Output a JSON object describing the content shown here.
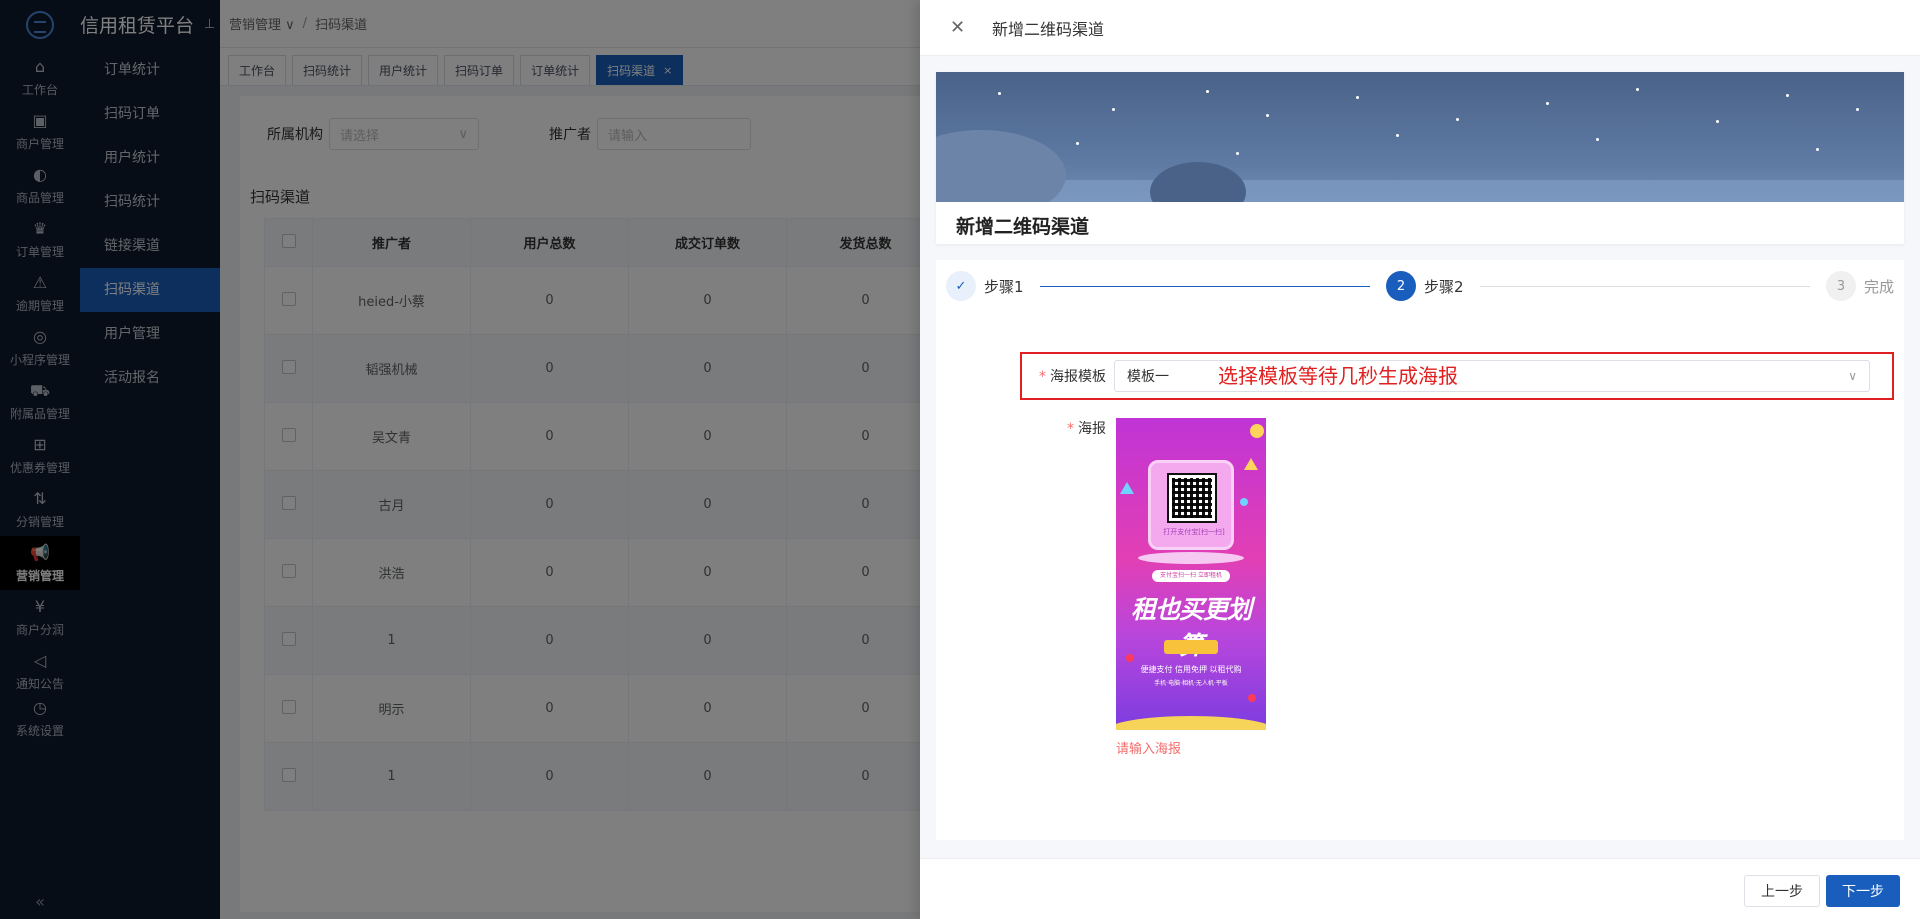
{
  "app": {
    "title": "信用租赁平台"
  },
  "rail": [
    {
      "icon": "⌂",
      "label": "工作台"
    },
    {
      "icon": "▣",
      "label": "商户管理"
    },
    {
      "icon": "◐",
      "label": "商品管理"
    },
    {
      "icon": "♛",
      "label": "订单管理"
    },
    {
      "icon": "⚠",
      "label": "逾期管理"
    },
    {
      "icon": "◎",
      "label": "小程序管理"
    },
    {
      "icon": "⛟",
      "label": "附属品管理"
    },
    {
      "icon": "⊞",
      "label": "优惠券管理"
    },
    {
      "icon": "⇅",
      "label": "分销管理"
    },
    {
      "icon": "📢",
      "label": "营销管理"
    },
    {
      "icon": "¥",
      "label": "商户分润"
    },
    {
      "icon": "◁",
      "label": "通知公告"
    },
    {
      "icon": "◷",
      "label": "系统设置"
    }
  ],
  "rail_collapse_icon": "«",
  "submenu": {
    "pin_icon": "⊥",
    "items": [
      "订单统计",
      "扫码订单",
      "用户统计",
      "扫码统计",
      "链接渠道",
      "扫码渠道",
      "用户管理",
      "活动报名"
    ],
    "active": "扫码渠道"
  },
  "breadcrumb": {
    "parent": "营销管理",
    "parent_arrow": "∨",
    "sep": "/",
    "current": "扫码渠道"
  },
  "tabs": [
    {
      "label": "工作台"
    },
    {
      "label": "扫码统计"
    },
    {
      "label": "用户统计"
    },
    {
      "label": "扫码订单"
    },
    {
      "label": "订单统计"
    },
    {
      "label": "扫码渠道",
      "close": "×"
    }
  ],
  "filter": {
    "org_label": "所属机构",
    "org_placeholder": "请选择",
    "org_arrow": "∨",
    "promoter_label": "推广者",
    "promoter_placeholder": "请输入"
  },
  "table": {
    "title": "扫码渠道",
    "columns": [
      "推广者",
      "用户总数",
      "成交订单数",
      "发货总数"
    ],
    "rows": [
      [
        "heied-小蔡",
        "0",
        "0",
        "0"
      ],
      [
        "韬强机械",
        "0",
        "0",
        "0"
      ],
      [
        "吴文青",
        "0",
        "0",
        "0"
      ],
      [
        "古月",
        "0",
        "0",
        "0"
      ],
      [
        "洪浩",
        "0",
        "0",
        "0"
      ],
      [
        "1",
        "0",
        "0",
        "0"
      ],
      [
        "明示",
        "0",
        "0",
        "0"
      ],
      [
        "1",
        "0",
        "0",
        "0"
      ]
    ]
  },
  "drawer": {
    "close_icon": "✕",
    "title": "新增二维码渠道",
    "banner_title": "新增二维码渠道",
    "steps": [
      {
        "num": "✓",
        "label": "步骤1",
        "state": "done"
      },
      {
        "num": "2",
        "label": "步骤2",
        "state": "current"
      },
      {
        "num": "3",
        "label": "完成",
        "state": "todo"
      }
    ],
    "template_label": "海报模板",
    "template_value": "模板一",
    "template_arrow": "∨",
    "annotation": "选择模板等待几秒生成海报",
    "poster_label": "海报",
    "required_mark": "*",
    "poster": {
      "caption": "打开支付宝[扫一扫]",
      "pill": "支付宝扫一扫 立即租机",
      "slogan": "租也买更划算",
      "tags": "便捷支付  信用免押  以租代购",
      "sub": "手机·电脑·相机·无人机·平板"
    },
    "error": "请输入海报",
    "prev_button": "上一步",
    "next_button": "下一步"
  },
  "colors": {
    "primary": "#1a5ebd",
    "sidebar": "#0f1a2c",
    "error": "#f56c6c",
    "annotation": "#e02020"
  }
}
